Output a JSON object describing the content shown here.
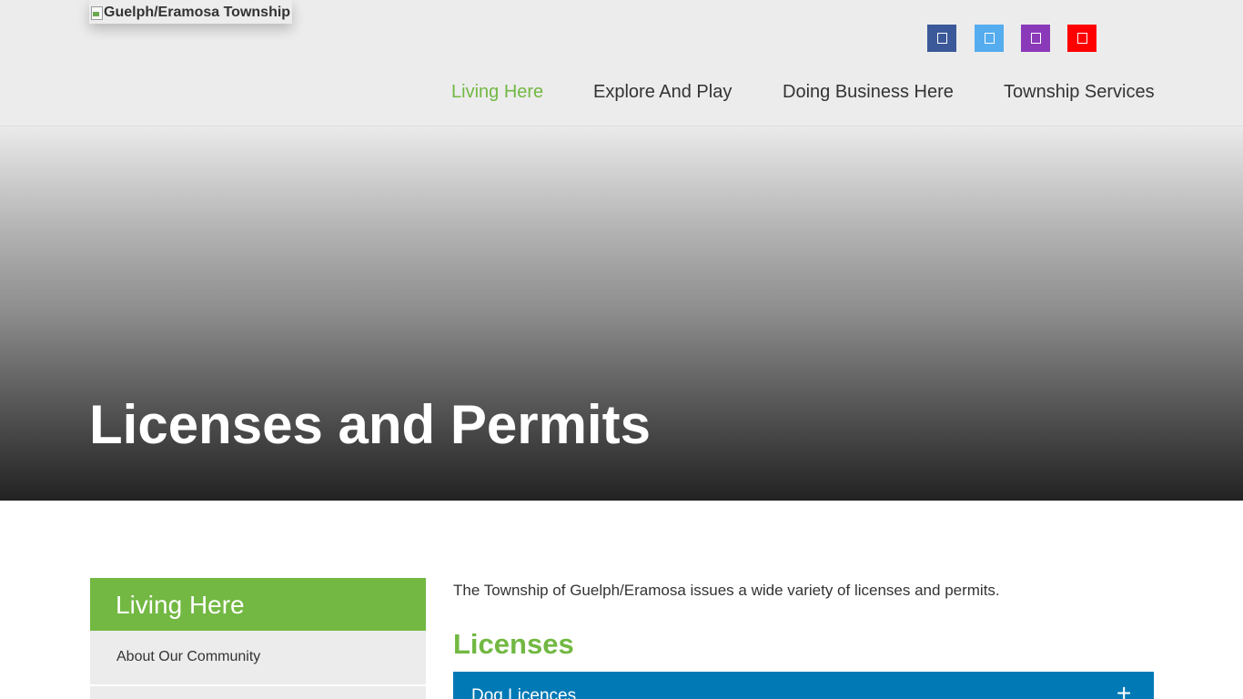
{
  "header": {
    "logo_alt": "Guelph/Eramosa Township",
    "social": [
      {
        "name": "facebook",
        "icon": "facebook-icon",
        "color": "#3b5998"
      },
      {
        "name": "twitter",
        "icon": "twitter-icon",
        "color": "#55acee"
      },
      {
        "name": "instagram",
        "icon": "instagram-icon",
        "color": "#8a3ab9"
      },
      {
        "name": "youtube",
        "icon": "youtube-icon",
        "color": "#ff0000"
      }
    ],
    "nav": [
      {
        "label": "Living Here",
        "active": true
      },
      {
        "label": "Explore And Play",
        "active": false
      },
      {
        "label": "Doing Business Here",
        "active": false
      },
      {
        "label": "Township Services",
        "active": false
      }
    ]
  },
  "hero": {
    "title": "Licenses and Permits"
  },
  "sidebar": {
    "title": "Living Here",
    "items": [
      {
        "label": "About Our Community"
      }
    ]
  },
  "main": {
    "intro": "The Township of Guelph/Eramosa issues a wide variety of licenses and permits.",
    "section_title": "Licenses",
    "accordion": [
      {
        "label": "Dog Licences",
        "toggle": "+"
      }
    ]
  },
  "colors": {
    "accent_green": "#72b843",
    "accordion_blue": "#0079b5",
    "header_bg": "#ececec"
  }
}
